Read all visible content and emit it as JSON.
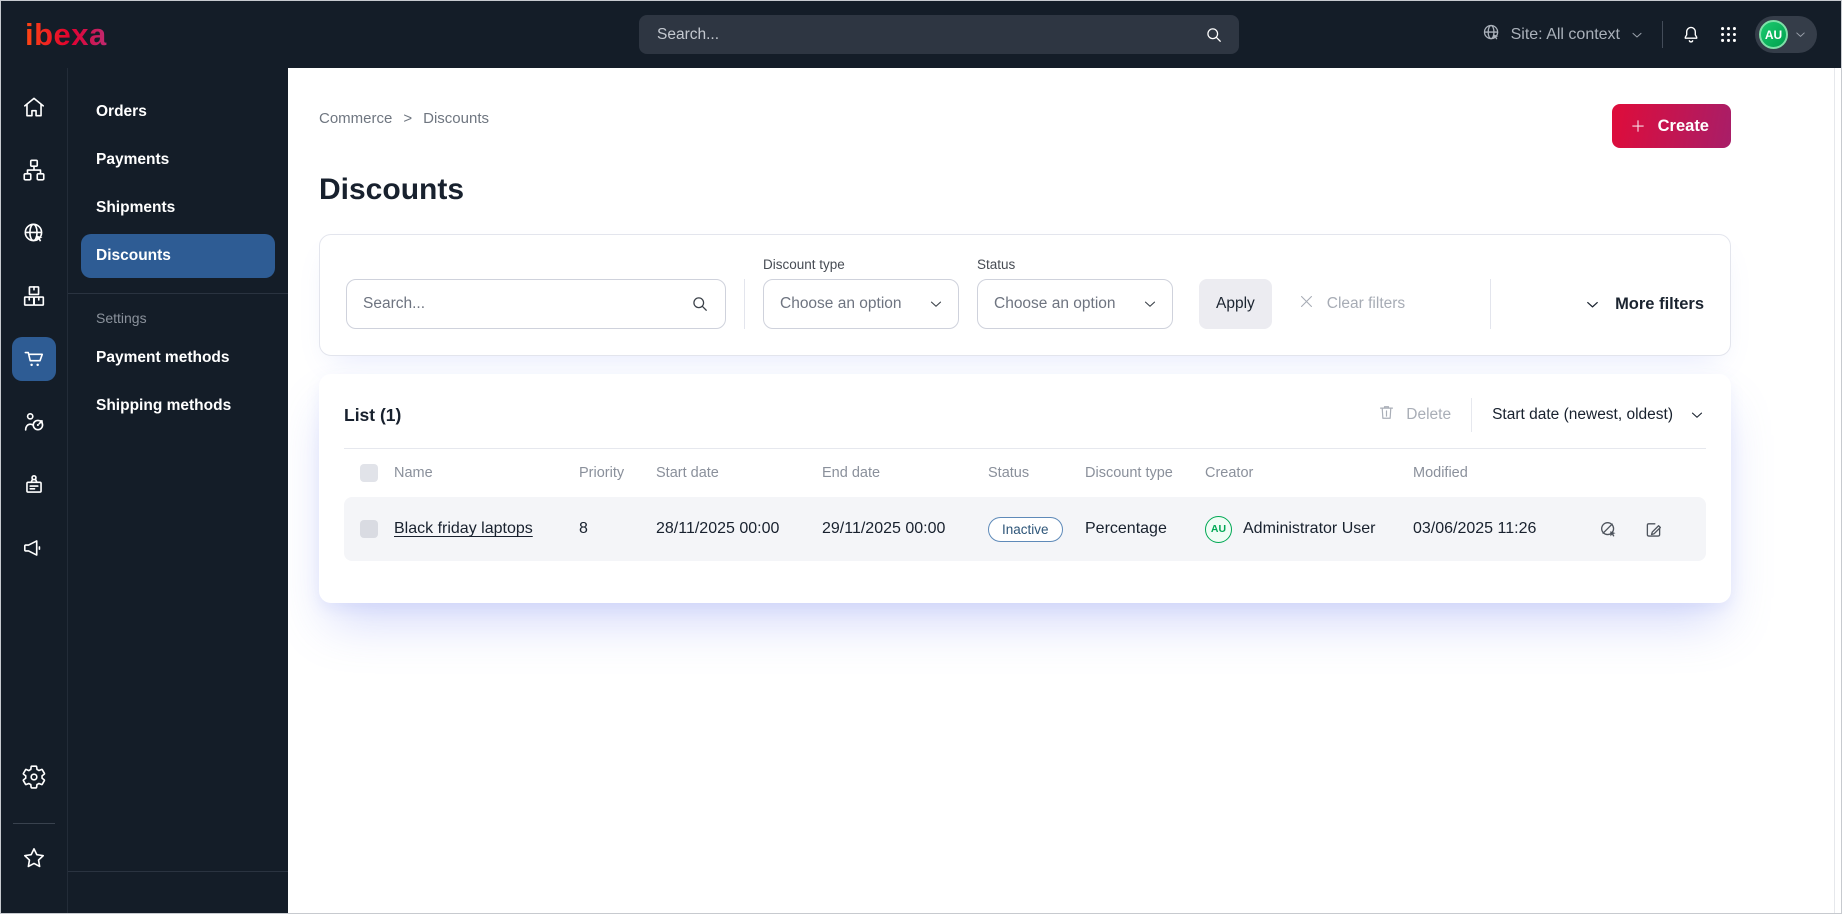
{
  "topbar": {
    "logo_text": "ibexa",
    "search_placeholder": "Search...",
    "site_label": "Site: All context",
    "avatar_initials": "AU",
    "icons": [
      "site-context-globe-icon",
      "search-icon",
      "notification-bell-icon",
      "app-grid-icon",
      "chevron-down-icon"
    ]
  },
  "rail": {
    "icons": [
      "home-icon",
      "content-tree-icon",
      "site-globe-icon",
      "products-boxes-icon",
      "commerce-cart-icon",
      "customer-target-icon",
      "corporate-badge-icon",
      "marketing-megaphone-icon",
      "settings-gear-icon",
      "bookmarks-star-icon"
    ],
    "active_icon": "commerce-cart-icon"
  },
  "menu": {
    "items": [
      {
        "label": "Orders",
        "active": false
      },
      {
        "label": "Payments",
        "active": false
      },
      {
        "label": "Shipments",
        "active": false
      },
      {
        "label": "Discounts",
        "active": true
      }
    ],
    "section_label": "Settings",
    "section_items": [
      {
        "label": "Payment methods"
      },
      {
        "label": "Shipping methods"
      }
    ]
  },
  "content": {
    "breadcrumb": {
      "parent": "Commerce",
      "separator": ">",
      "current": "Discounts"
    },
    "create_label": "Create",
    "title": "Discounts",
    "filters": {
      "search_placeholder": "Search...",
      "discount_type_label": "Discount type",
      "discount_type_value": "Choose an option",
      "status_label": "Status",
      "status_value": "Choose an option",
      "apply_label": "Apply",
      "clear_label": "Clear filters",
      "more_filters_label": "More filters"
    },
    "list": {
      "title": "List (1)",
      "delete_label": "Delete",
      "sort_label": "Start date (newest, oldest)",
      "columns": [
        "Name",
        "Priority",
        "Start date",
        "End date",
        "Status",
        "Discount type",
        "Creator",
        "Modified"
      ],
      "rows": [
        {
          "name": "Black friday laptops",
          "priority": "8",
          "start_date": "28/11/2025 00:00",
          "end_date": "29/11/2025 00:00",
          "status": "Inactive",
          "discount_type": "Percentage",
          "creator_initials": "AU",
          "creator": "Administrator User",
          "modified": "03/06/2025 11:26",
          "actions": [
            "preview-disabled-icon",
            "edit-icon"
          ]
        }
      ]
    }
  },
  "colors": {
    "topbar_bg": "#141d28",
    "active_item_blue": "#2e5c94",
    "brand_gradient_start": "#df0c3a",
    "brand_gradient_end": "#a81e68",
    "status_inactive_border": "#5e8ab9",
    "status_inactive_text": "#2e5679",
    "avatar_green": "#00a854",
    "row_bg": "#f4f5f8"
  }
}
